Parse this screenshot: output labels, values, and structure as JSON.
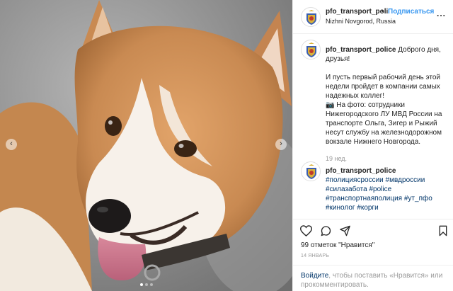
{
  "post": {
    "photo_alt": "corgi dog photo",
    "carousel": {
      "total": 3,
      "active": 1
    }
  },
  "header": {
    "username": "pfo_transport_poli",
    "separator": "•",
    "follow_label": "Подписаться",
    "location": "Nizhni Novgorod, Russia",
    "more_label": "..."
  },
  "caption": {
    "username": "pfo_transport_police",
    "line1": "Доброго дня, друзья!",
    "para2": "И пусть первый рабочий день этой недели пройдет в компании самых надежных коллег!",
    "para3": "📷 На фото: сотрудники Нижегородского ЛУ МВД России на транспорте Ольга, Зигер и Рыжий несут службу на железнодорожном вокзале Нижнего Новгорода.",
    "timestamp": "19 нед."
  },
  "comment": {
    "username": "pfo_transport_police",
    "tags": "#полициясроссии #мвдроссии #силазабота #police #транспортнаяполиция #ут_пфо #кинолог #корги"
  },
  "stats": {
    "likes": "99 отметок \"Нравится\"",
    "date": "14 ЯНВАРЬ"
  },
  "login_prompt": {
    "login_link": "Войдите",
    "text": ", чтобы поставить «Нравится» или прокомментировать."
  },
  "colors": {
    "link_blue": "#3897f0",
    "hashtag": "#003569",
    "muted": "#999999"
  }
}
